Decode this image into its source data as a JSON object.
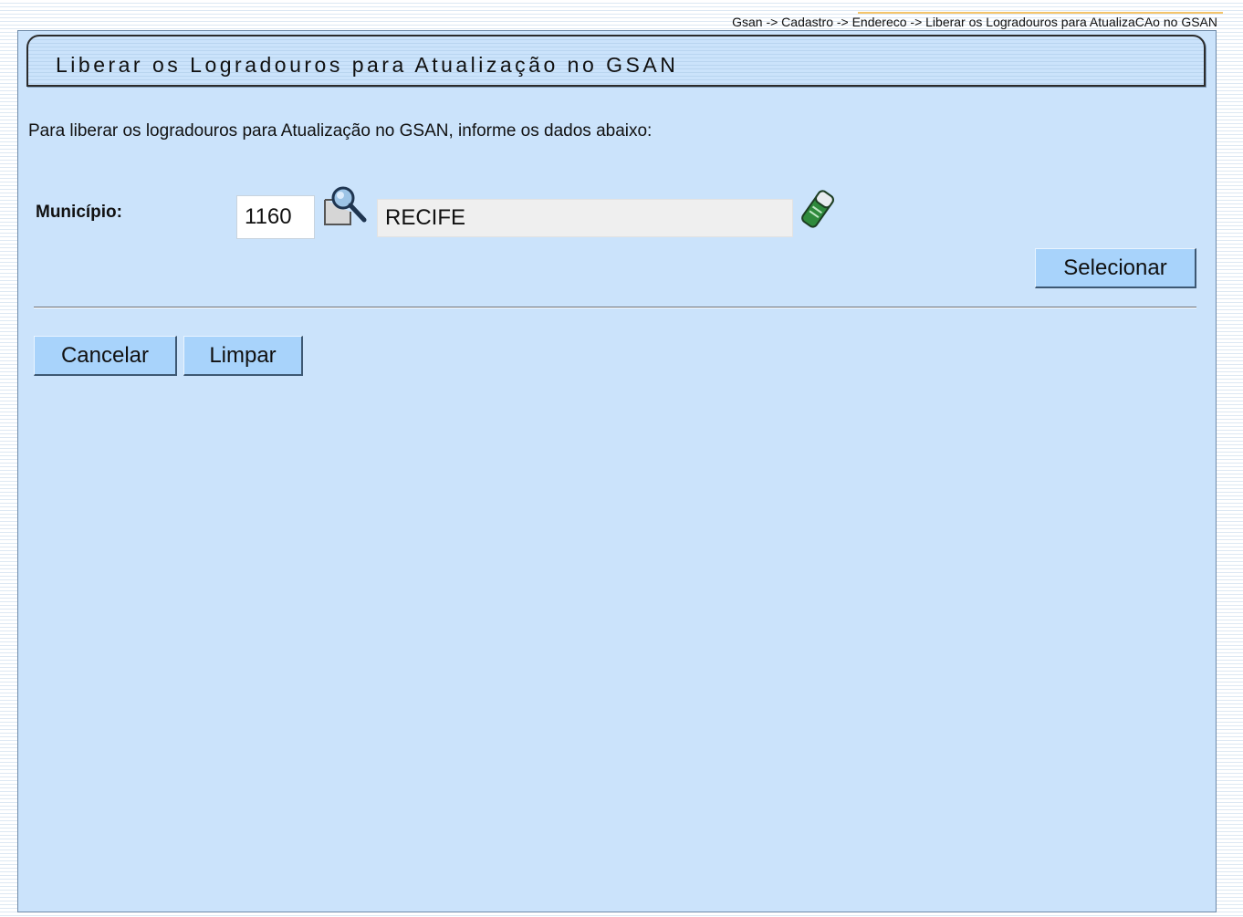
{
  "breadcrumb": "Gsan -> Cadastro -> Endereco -> Liberar os Logradouros para AtualizaCAo no GSAN",
  "title": "Liberar os Logradouros para Atualização no GSAN",
  "intro": "Para liberar os logradouros para Atualização no GSAN, informe os dados abaixo:",
  "municipio": {
    "label": "Município:",
    "code": "1160",
    "name": "RECIFE",
    "search_icon": "magnifier-search-icon",
    "clear_icon": "eraser-icon"
  },
  "buttons": {
    "selecionar": "Selecionar",
    "cancelar": "Cancelar",
    "limpar": "Limpar"
  },
  "colors": {
    "panel_background": "#cbe3fb",
    "button_background": "#a8d3fb",
    "accent": "#f5c56a"
  }
}
